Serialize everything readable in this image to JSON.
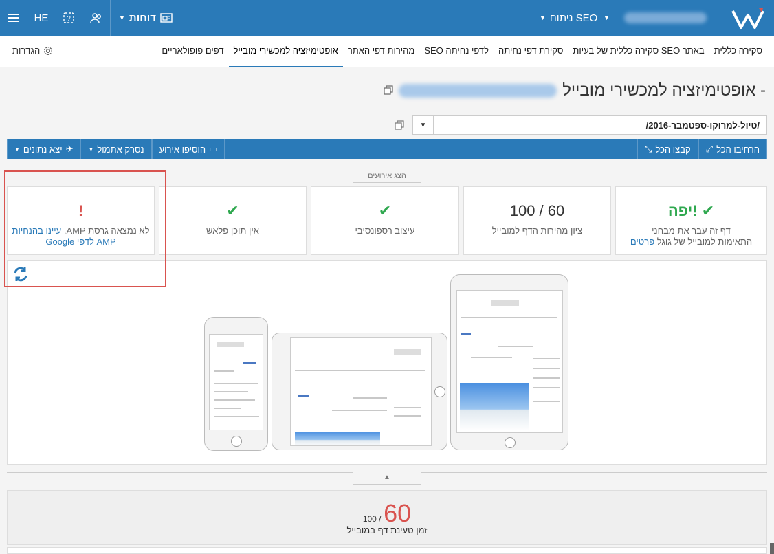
{
  "topbar": {
    "brand_icon": "w-logo",
    "site_dropdown_label": "ניתוח SEO",
    "reports_label": "דוחות",
    "lang_label": "HE",
    "icons": [
      "menu-icon",
      "help-icon",
      "users-icon",
      "reports-icon"
    ]
  },
  "tabs": [
    {
      "label": "סקירה כללית",
      "active": false
    },
    {
      "label": "סקירה כללית של בעיות SEO באתר",
      "active": false
    },
    {
      "label": "סקירת דפי נחיתה",
      "active": false
    },
    {
      "label": "SEO לדפי נחיתה",
      "active": false
    },
    {
      "label": "מהירות דפי האתר",
      "active": false
    },
    {
      "label": "אופטימיזציה למכשירי מובייל",
      "active": true
    },
    {
      "label": "דפים פופולאריים",
      "active": false
    }
  ],
  "settings_label": "הגדרות",
  "page": {
    "title": "אופטימיזציה למכשירי מובייל -",
    "url_value": "/טיול-למרוקו-ספטמבר-2016/"
  },
  "actionbar": {
    "expand_all": "הרחיבו הכל",
    "collapse_all": "קבצו הכל",
    "add_event": "הוסיפו אירוע",
    "template": "נסרק אתמול",
    "export": "יצא נתונים"
  },
  "events_tab": "הצג אירועים",
  "cards": {
    "verdict": {
      "big": "יפה!",
      "desc_1": "דף זה עבר את מבחני",
      "desc_2": "התאימות למובייל של גוגל",
      "link": "פרטים"
    },
    "speed": {
      "big": "100 / 60",
      "desc": "ציון מהירות הדף למובייל"
    },
    "responsive": {
      "desc": "עיצוב רספונסיבי"
    },
    "flash": {
      "desc": "אין תוכן פלאש"
    },
    "amp": {
      "desc_plain": "לא נמצאה גרסת AMP.",
      "desc_link_1": "עיינו בהנחיות",
      "desc_link_2": "AMP לדפי Google"
    }
  },
  "score": {
    "value": "60",
    "out_of": "100 /",
    "label": "זמן טעינת דף במובייל"
  },
  "colors": {
    "primary": "#2a7ab8",
    "success": "#2fa84f",
    "danger": "#d9534f"
  }
}
